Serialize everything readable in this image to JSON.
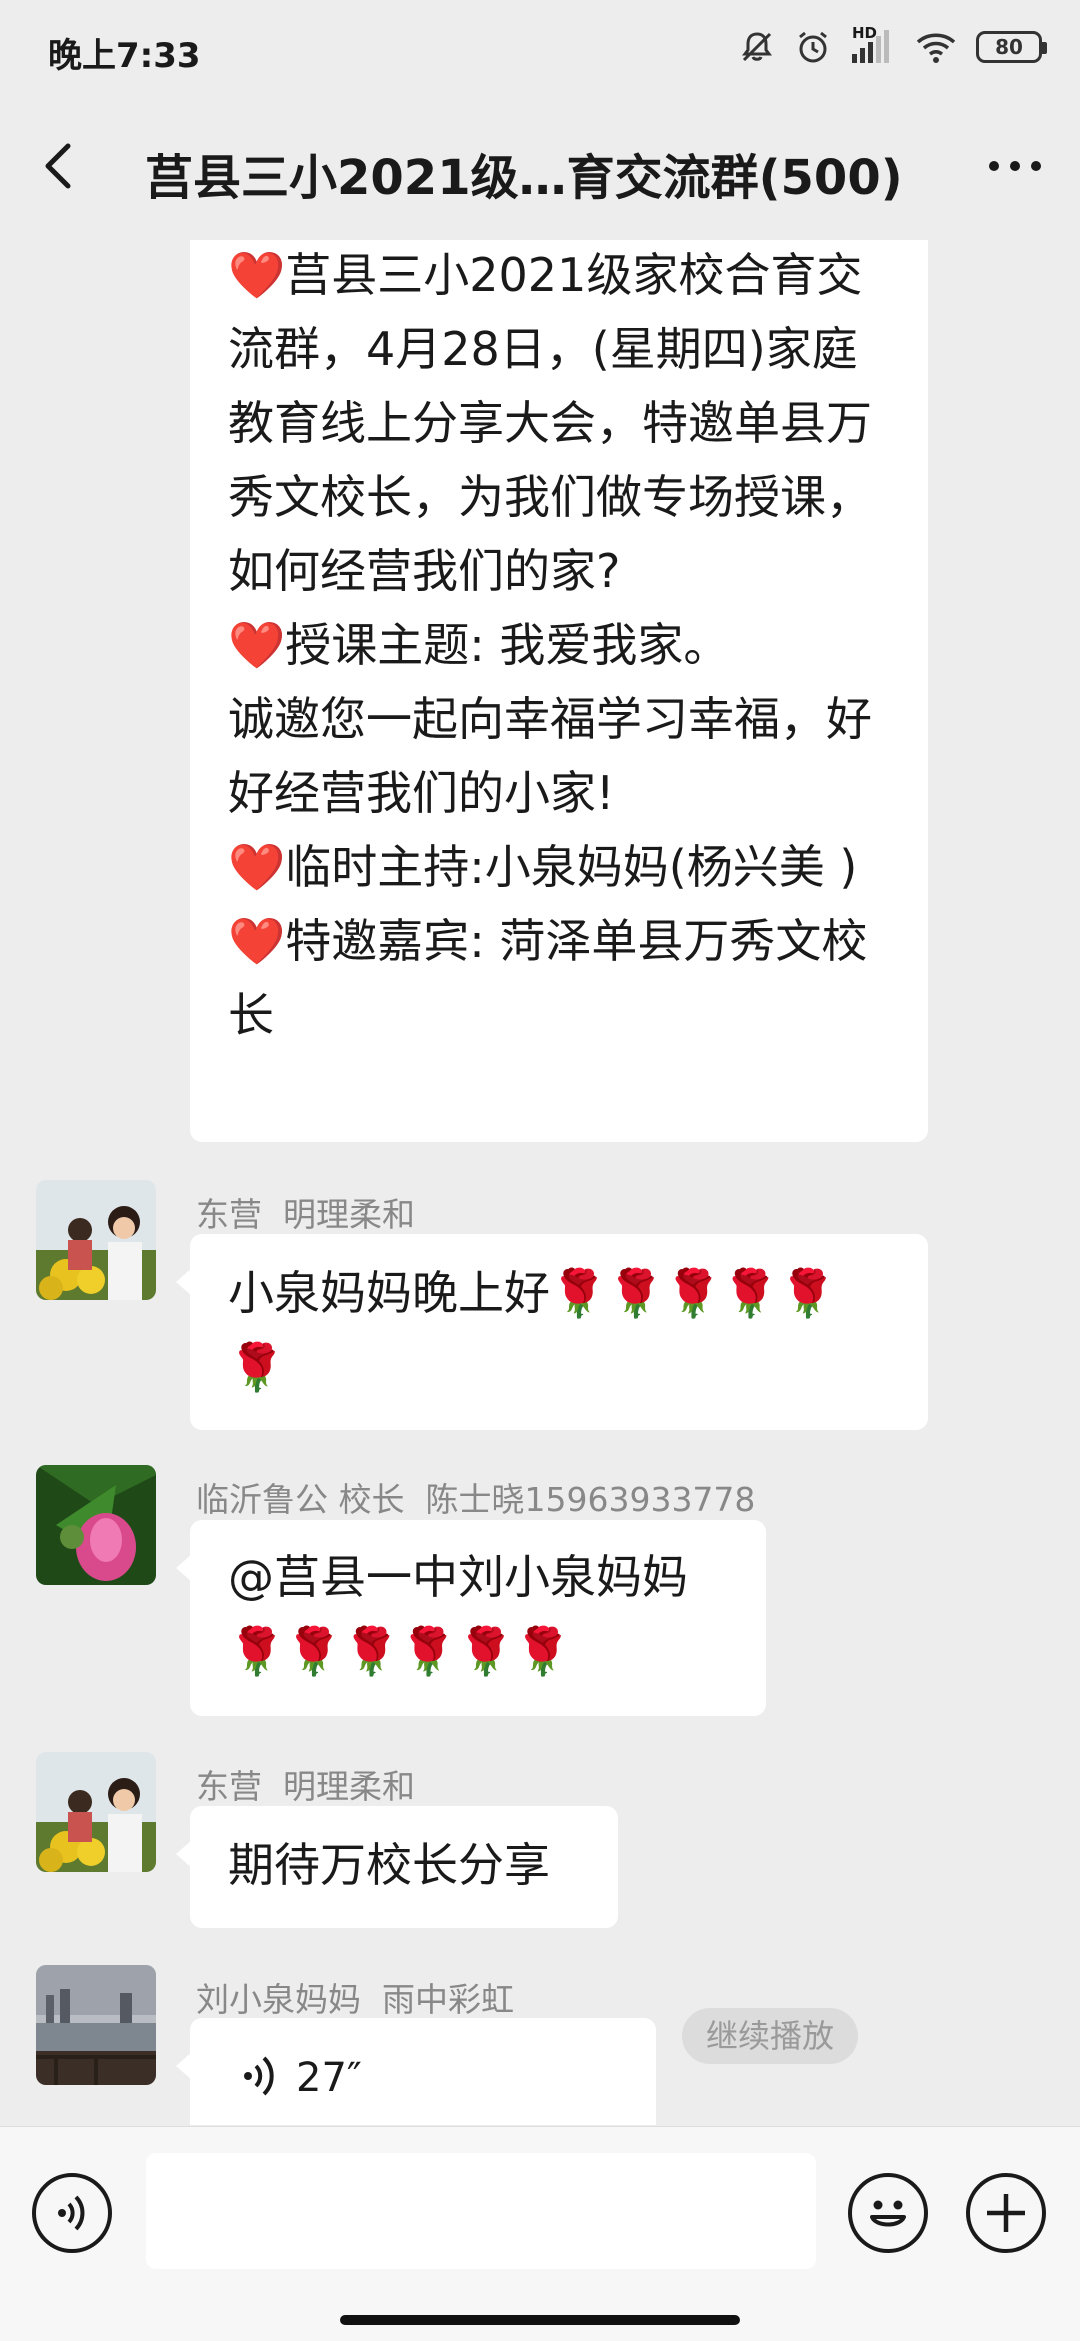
{
  "status_bar": {
    "time": "晚上7:33",
    "battery": "80",
    "network": "HD",
    "icons": [
      "mute-icon",
      "alarm-icon",
      "signal-icon",
      "wifi-icon",
      "battery-icon"
    ]
  },
  "header": {
    "title": "莒县三小2021级…育交流群(500)",
    "back_icon": "back-arrow-icon",
    "more_icon": "more-icon"
  },
  "messages": [
    {
      "text": "❤️莒县三小2021级家校合育交流群，4月28日，(星期四)家庭教育线上分享大会，特邀单县万秀文校长，为我们做专场授课，如何经营我们的家?\n❤️授课主题: 我爱我家。\n诚邀您一起向幸福学习幸福，好好经营我们的小家!\n❤️临时主持:小泉妈妈(杨兴美 )\n❤️特邀嘉宾: 菏泽单县万秀文校长"
    },
    {
      "sender": "东营  明理柔和",
      "text": "小泉妈妈晚上好🌹🌹🌹🌹🌹🌹"
    },
    {
      "sender": "临沂鲁公 校长  陈士晓15963933778",
      "text": "@莒县一中刘小泉妈妈 🌹🌹🌹🌹🌹🌹"
    },
    {
      "sender": "东营  明理柔和",
      "text": "期待万校长分享"
    },
    {
      "sender": "刘小泉妈妈  雨中彩虹",
      "voice_duration": "27″",
      "continue_label": "继续播放"
    }
  ],
  "input_bar": {
    "placeholder": "",
    "voice_icon": "voice-input-icon",
    "emoji_icon": "emoji-icon",
    "plus_icon": "plus-icon"
  },
  "colors": {
    "background": "#ededed",
    "bubble": "#ffffff",
    "sender_text": "#888888"
  }
}
